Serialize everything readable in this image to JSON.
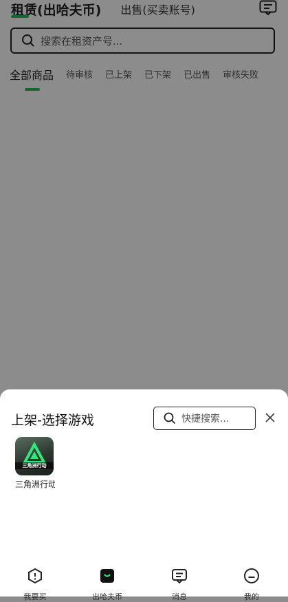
{
  "header": {
    "active_tab": "租赁(出哈夫币)",
    "other_tab": "出售(买卖账号)",
    "message_icon": "message-icon"
  },
  "search": {
    "placeholder": "搜索在租资产号..."
  },
  "filter_tabs": [
    "全部商品",
    "待审核",
    "已上架",
    "已下架",
    "已出售",
    "审核失败"
  ],
  "sheet": {
    "title": "上架-选择游戏",
    "search_placeholder": "快捷搜索...",
    "games": [
      {
        "name": "三角洲行动",
        "icon": "三角洲行动"
      }
    ]
  },
  "bottom_nav": [
    {
      "label": "我要买",
      "icon": "buy-icon"
    },
    {
      "label": "出哈夫币",
      "icon": "sell-icon",
      "active": true
    },
    {
      "label": "消息",
      "icon": "message-icon"
    },
    {
      "label": "我的",
      "icon": "profile-icon"
    }
  ],
  "colors": {
    "accent": "#1fbf5a",
    "overlay": "#8c8c8c"
  }
}
